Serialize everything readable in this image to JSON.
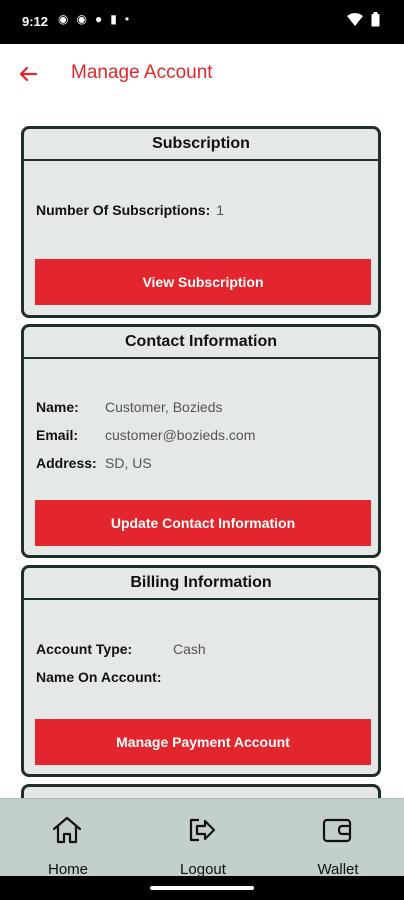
{
  "status_bar": {
    "time": "9:12"
  },
  "header": {
    "title": "Manage Account"
  },
  "subscription_card": {
    "title": "Subscription",
    "label": "Number Of Subscriptions:",
    "value": "1",
    "button": "View Subscription"
  },
  "contact_card": {
    "title": "Contact Information",
    "fields": [
      {
        "label": "Name:",
        "value": "Customer, Bozieds"
      },
      {
        "label": "Email:",
        "value": "customer@bozieds.com"
      },
      {
        "label": "Address:",
        "value": "SD, US"
      }
    ],
    "button": "Update Contact Information"
  },
  "billing_card": {
    "title": "Billing Information",
    "fields": [
      {
        "label": "Account Type:",
        "value": "Cash"
      },
      {
        "label": "Name On Account:",
        "value": ""
      }
    ],
    "button": "Manage Payment Account"
  },
  "bottom_nav": {
    "items": [
      {
        "label": "Home",
        "icon": "home-icon"
      },
      {
        "label": "Logout",
        "icon": "logout-icon"
      },
      {
        "label": "Wallet",
        "icon": "wallet-icon"
      }
    ]
  },
  "colors": {
    "accent": "#e3262d",
    "card_bg": "#e4e8e6",
    "card_border": "#1e2f2a",
    "nav_bg": "#c3cfcc"
  }
}
